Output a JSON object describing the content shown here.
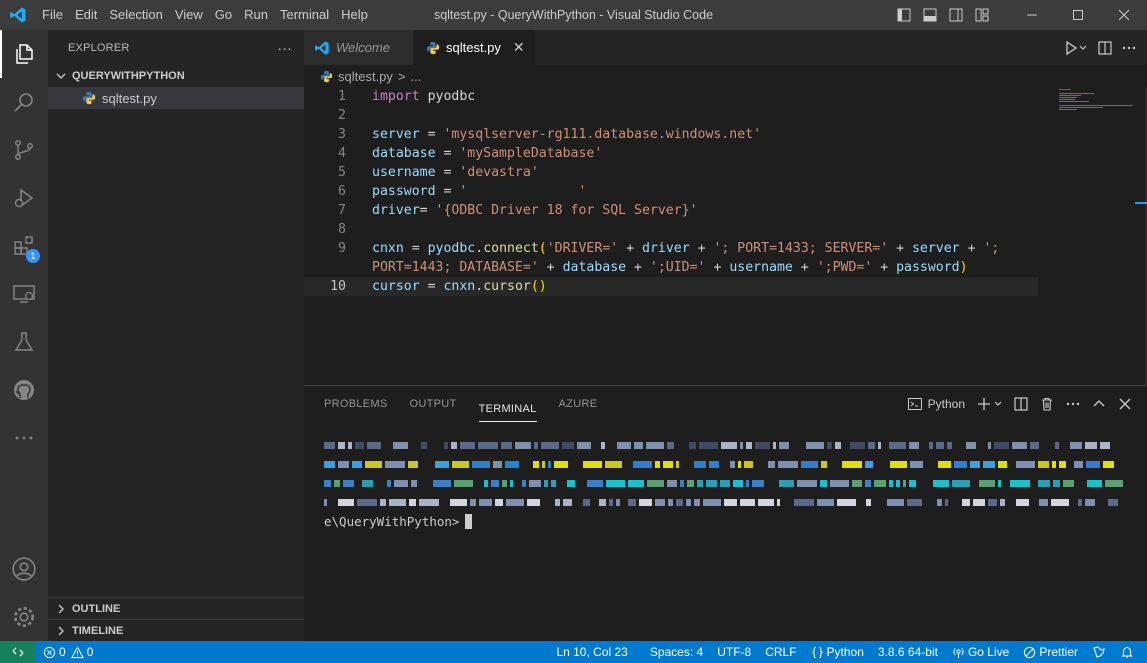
{
  "window": {
    "title": "sqltest.py - QueryWithPython - Visual Studio Code",
    "menu": [
      "File",
      "Edit",
      "Selection",
      "View",
      "Go",
      "Run",
      "Terminal",
      "Help"
    ]
  },
  "activity_bar": {
    "items": [
      "explorer-icon",
      "search-icon",
      "source-control-icon",
      "run-debug-icon",
      "extensions-icon",
      "remote-explorer-icon",
      "testing-icon",
      "github-icon",
      "more-icon"
    ],
    "extensions_badge": "1",
    "bottom": [
      "account-icon",
      "manage-gear-icon"
    ]
  },
  "sidebar": {
    "header": "EXPLORER",
    "more": "···",
    "folder": "QUERYWITHPYTHON",
    "file": "sqltest.py",
    "outline": "OUTLINE",
    "timeline": "TIMELINE"
  },
  "editor": {
    "tabs": [
      {
        "label": "Welcome",
        "active": false
      },
      {
        "label": "sqltest.py",
        "active": true
      }
    ],
    "close_glyph": "✕",
    "breadcrumb": {
      "file": "sqltest.py",
      "sep": ">",
      "rest": "..."
    },
    "line_numbers": [
      "1",
      "2",
      "3",
      "4",
      "5",
      "6",
      "7",
      "8",
      "9",
      "",
      "10"
    ],
    "code": {
      "l1_kw": "import",
      "l1_rest": " pyodbc",
      "l3_var": "server",
      "l3_eq": " = ",
      "l3_str": "'mysqlserver-rg111.database.windows.net'",
      "l4_var": "database",
      "l4_eq": " = ",
      "l4_str": "'mySampleDatabase'",
      "l5_var": "username",
      "l5_eq": " = ",
      "l5_str": "'devastra'",
      "l6_var": "password",
      "l6_eq": " = ",
      "l6_str": "'              '",
      "l7_var": "driver",
      "l7_eq": "= ",
      "l7_str": "'{ODBC Driver 18 for SQL Server}'",
      "l9_a": "cnxn",
      "l9_b": " = ",
      "l9_c": "pyodbc",
      "l9_d": ".",
      "l9_e": "connect",
      "l9_f": "(",
      "l9_g": "'DRIVER='",
      "l9_h": " + ",
      "l9_i": "driver",
      "l9_j": " + ",
      "l9_k": "'; PORT=1433; SERVER='",
      "l9_l": " + ",
      "l9_m": "server",
      "l9_n": " + ",
      "l9_o": "';",
      "l9w_a": "PORT=1443; DATABASE='",
      "l9w_b": " + ",
      "l9w_c": "database",
      "l9w_d": " + ",
      "l9w_e": "';UID='",
      "l9w_f": " + ",
      "l9w_g": "username",
      "l9w_h": " + ",
      "l9w_i": "';PWD='",
      "l9w_j": " + ",
      "l9w_k": "password",
      "l9w_l": ")",
      "l10_a": "cursor",
      "l10_b": " = ",
      "l10_c": "cnxn",
      "l10_d": ".",
      "l10_e": "cursor",
      "l10_f": "()"
    }
  },
  "panel": {
    "tabs": [
      "PROBLEMS",
      "OUTPUT",
      "TERMINAL",
      "AZURE"
    ],
    "active_tab": "TERMINAL",
    "terminal_name": "Python",
    "terminal_prompt": "e\\QueryWithPython>"
  },
  "status_bar": {
    "errors": "0",
    "warnings": "0",
    "position": "Ln 10, Col 23",
    "spaces": "Spaces: 4",
    "encoding": "UTF-8",
    "eol": "CRLF",
    "language": "Python",
    "interpreter": "3.8.6 64-bit",
    "go_live": "Go Live",
    "prettier": "Prettier"
  },
  "colors": {
    "accent": "#007acc",
    "keyword": "#c586c0",
    "string": "#ce9178",
    "variable": "#9cdcfe",
    "function": "#dcdcaa"
  }
}
